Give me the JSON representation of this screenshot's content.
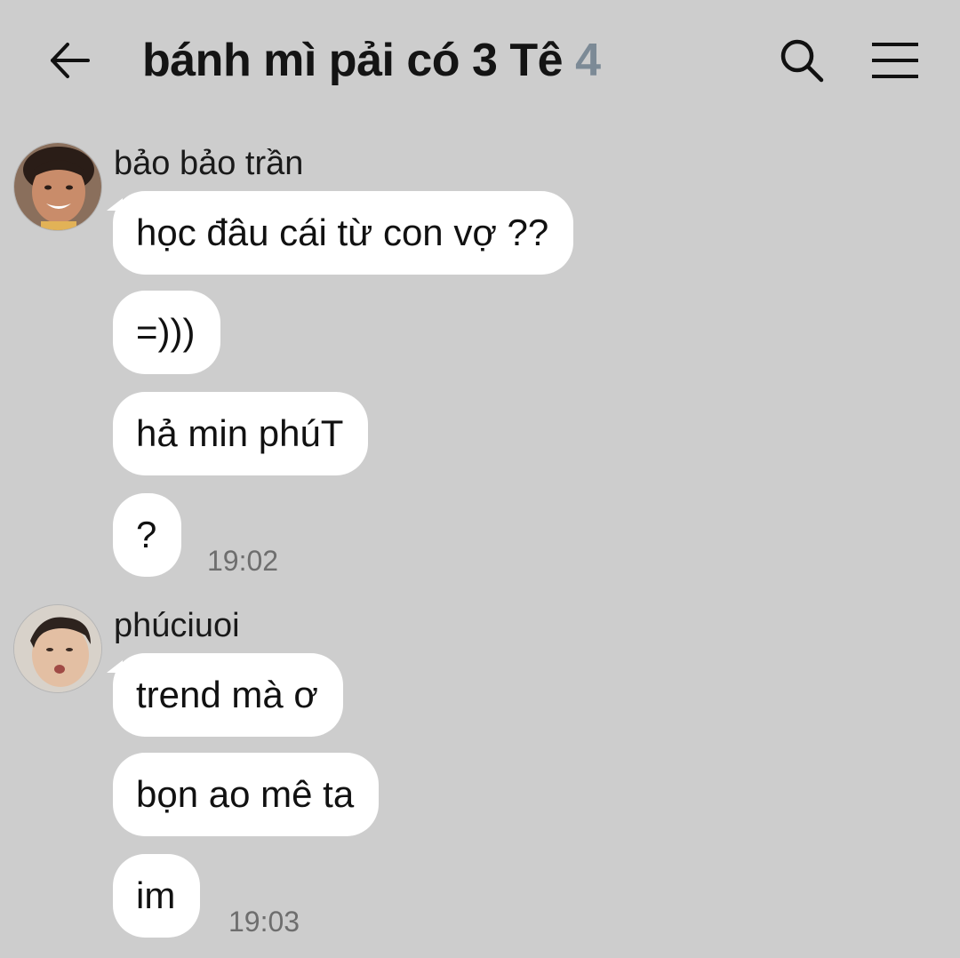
{
  "header": {
    "title": "bánh mì pải có 3 Tê",
    "member_count": "4",
    "back_icon": "arrow-left-icon",
    "search_icon": "search-icon",
    "menu_icon": "hamburger-menu-icon"
  },
  "colors": {
    "background": "#cdcdcd",
    "bubble": "#ffffff",
    "count_accent": "#7c8a96",
    "timestamp": "#6e6e6e"
  },
  "groups": [
    {
      "sender": "bảo bảo trần",
      "messages": [
        "học đâu cái từ con vợ ??",
        "=)))",
        "hả min phúT",
        "?"
      ],
      "time": "19:02"
    },
    {
      "sender": "phúciuoi",
      "messages": [
        "trend mà ơ",
        "bọn ao mê ta",
        "im"
      ],
      "time": "19:03"
    }
  ]
}
